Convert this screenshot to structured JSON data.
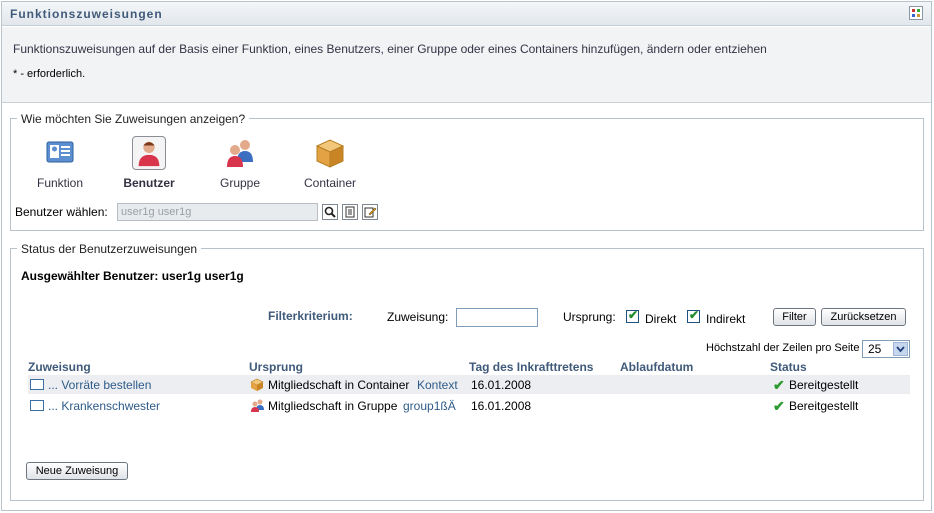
{
  "window": {
    "title": "Funktionszuweisungen"
  },
  "description": {
    "text": "Funktionszuweisungen auf der Basis einer Funktion, eines Benutzers, einer Gruppe oder eines Containers hinzufügen, ändern oder entziehen",
    "required_note": "* - erforderlich."
  },
  "view": {
    "legend": "Wie möchten Sie Zuweisungen anzeigen?",
    "options": [
      {
        "label": "Funktion",
        "icon": "role-icon"
      },
      {
        "label": "Benutzer",
        "icon": "user-icon",
        "selected": true
      },
      {
        "label": "Gruppe",
        "icon": "group-icon"
      },
      {
        "label": "Container",
        "icon": "container-icon"
      }
    ],
    "user_select_label": "Benutzer wählen:",
    "user_select_value": "user1g user1g"
  },
  "status": {
    "legend": "Status der Benutzerzuweisungen",
    "selected_user": "Ausgewählter Benutzer:  user1g user1g",
    "filter": {
      "label": "Filterkriterium:",
      "zuweisung_label": "Zuweisung:",
      "zuweisung_value": "",
      "ursprung_label": "Ursprung:",
      "direkt_label": "Direkt",
      "direkt_checked": true,
      "indirekt_label": "Indirekt",
      "indirekt_checked": true,
      "filter_button": "Filter",
      "reset_button": "Zurücksetzen"
    },
    "rows_per_page_label": "Höchstzahl der Zeilen pro Seite",
    "rows_per_page_value": "25",
    "columns": [
      "Zuweisung",
      "Ursprung",
      "Tag des Inkrafttretens",
      "Ablaufdatum",
      "Status"
    ],
    "rows": [
      {
        "zuweisung": "... Vorräte bestellen",
        "ursprung_text": "Mitgliedschaft in Container",
        "ursprung_link": "Kontext",
        "ursprung_icon": "container-icon",
        "date": "16.01.2008",
        "ablauf": "",
        "status": "Bereitgestellt"
      },
      {
        "zuweisung": "... Krankenschwester",
        "ursprung_text": "Mitgliedschaft in Gruppe",
        "ursprung_link": "group1ßÄ",
        "ursprung_icon": "group-icon",
        "date": "16.01.2008",
        "ablauf": "",
        "status": "Bereitgestellt"
      }
    ],
    "new_button": "Neue Zuweisung"
  },
  "colors": {
    "accent": "#3f5a7a",
    "link": "#2e5b8a",
    "border": "#b9c3cc",
    "ok": "#2e9a30"
  }
}
